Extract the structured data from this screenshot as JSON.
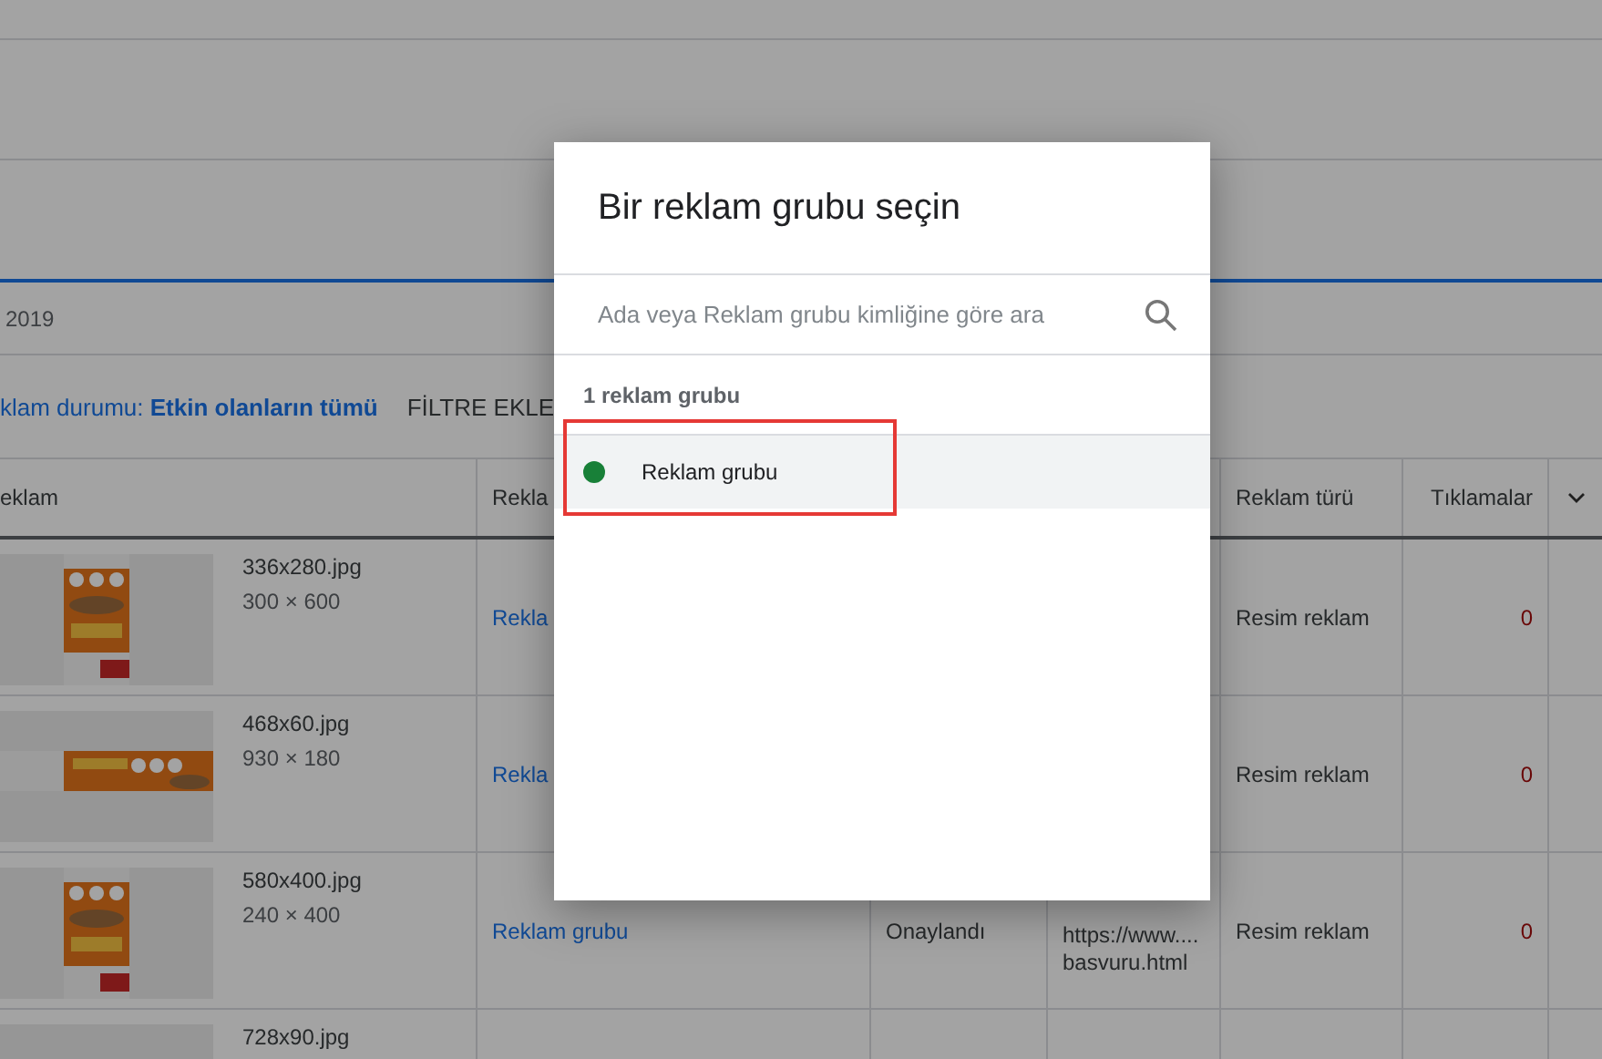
{
  "page": {
    "date": "2019",
    "filter": "klam durumu: **Etkin olanların tümü**",
    "add_filter": "FİLTRE EKLE"
  },
  "table": {
    "columns": {
      "ad": "eklam",
      "ad_group": "Rekla",
      "ad_type": "Reklam türü",
      "clicks": "Tıklamalar"
    },
    "rows": [
      {
        "kind": "portrait",
        "file": "336x280.jpg",
        "size": "300 × 600",
        "ad_group": "Rekla",
        "ad_type": "Resim reklam",
        "clicks": "0"
      },
      {
        "kind": "banner",
        "file": "468x60.jpg",
        "size": "930 × 180",
        "ad_group": "Rekla",
        "ad_type": "Resim reklam",
        "clicks": "0"
      },
      {
        "kind": "portrait",
        "file": "580x400.jpg",
        "size": "240 × 400",
        "ad_group": "Reklam grubu",
        "status": "Onaylandı",
        "final_url": [
          "https://www....",
          "basvuru.html"
        ],
        "ad_type": "Resim reklam",
        "clicks": "0"
      },
      {
        "file": "728x90.jpg"
      }
    ]
  },
  "dialog": {
    "title": "Bir reklam grubu seçin",
    "search": {
      "placeholder": "Ada veya Reklam grubu kimliğine göre ara"
    },
    "count": "1 reklam grubu",
    "items": [
      {
        "label": "Reklam grubu",
        "color": "#188038",
        "selected": true,
        "highlighted": true
      }
    ]
  }
}
